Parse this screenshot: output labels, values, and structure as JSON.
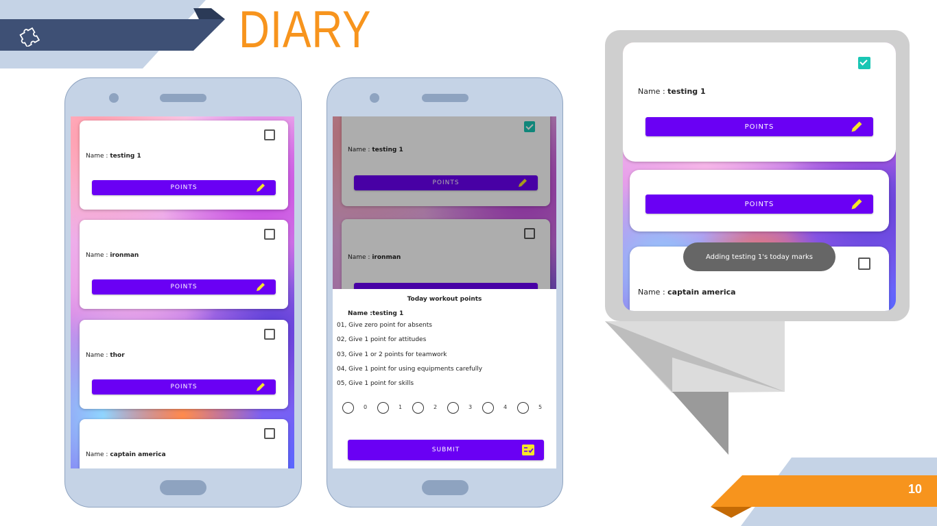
{
  "slide": {
    "title": "DIARY",
    "page_number": "10"
  },
  "colors": {
    "accent": "#f7941d",
    "brand_purple": "#6a00f4",
    "check_teal": "#19c6b4",
    "pen_yellow": "#f5e52a"
  },
  "icons": {
    "corner": "puzzle-icon",
    "edit": "pencil-icon",
    "submit": "checklist-icon"
  },
  "phone1": {
    "cards": [
      {
        "name_label": "Name :",
        "name_value": "testing 1",
        "button": "POINTS",
        "checked": false
      },
      {
        "name_label": "Name :",
        "name_value": "ironman",
        "button": "POINTS",
        "checked": false
      },
      {
        "name_label": "Name :",
        "name_value": "thor",
        "button": "POINTS",
        "checked": false
      },
      {
        "name_label": "Name :",
        "name_value": "captain america",
        "checked": false
      }
    ]
  },
  "phone2": {
    "cards": [
      {
        "name_label": "Name :",
        "name_value": "testing 1",
        "button": "POINTS",
        "checked": true
      },
      {
        "name_label": "Name :",
        "name_value": "ironman",
        "checked": false
      }
    ],
    "sheet": {
      "title": "Today workout points",
      "name_line": "Name :testing 1",
      "rules": [
        "01, Give zero point for absents",
        "02, Give 1 point for attitudes",
        "03, Give 1 or 2 points for teamwork",
        "04, Give 1 point for using equipments carefully",
        "05, Give 1 point for skills"
      ],
      "options": [
        "0",
        "1",
        "2",
        "3",
        "4",
        "5"
      ],
      "submit": "SUBMIT"
    }
  },
  "zoom": {
    "card1": {
      "name_label": "Name :",
      "name_value": "testing 1",
      "button": "POINTS",
      "checked": true
    },
    "card2": {
      "button": "POINTS"
    },
    "toast": "Adding testing 1's today marks",
    "card3": {
      "name_label": "Name :",
      "name_value": "captain america",
      "checked": false
    }
  }
}
